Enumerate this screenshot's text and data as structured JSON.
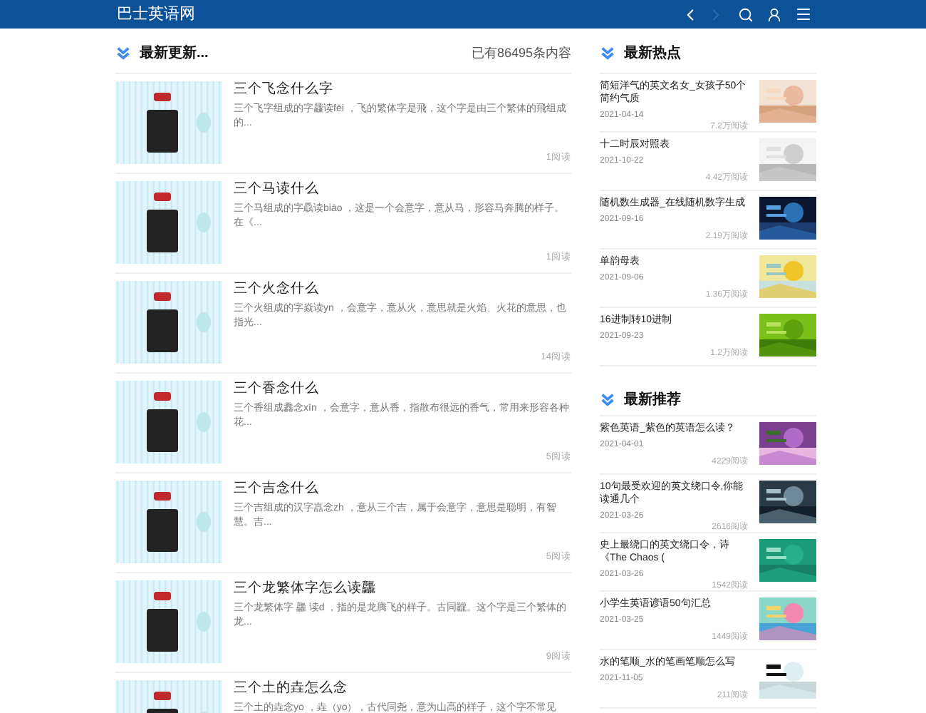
{
  "header": {
    "site_title": "巴士英语网"
  },
  "latest": {
    "title": "最新更新...",
    "count": "已有86495条内容",
    "items": [
      {
        "title": "三个飞念什么字",
        "summary": "三个飞字组成的字飝读fēi ，飞的繁体字是飛，这个字是由三个繁体的飛组成的...",
        "reads": "1阅读"
      },
      {
        "title": "三个马读什么",
        "summary": "三个马组成的字驫读biāo ，这是一个会意字，意从马，形容马奔腾的样子。在《...",
        "reads": "1阅读"
      },
      {
        "title": "三个火念什么",
        "summary": "三个火组成的字焱读yn ，会意字，意从火，意思就是火焰、火花的意思，也指光...",
        "reads": "14阅读"
      },
      {
        "title": "三个香念什么",
        "summary": "三个香组成馫念xīn ，会意字，意从香，指散布很远的香气，常用来形容各种花...",
        "reads": "5阅读"
      },
      {
        "title": "三个吉念什么",
        "summary": "三个吉组成的汉字嚞念zh ，意从三个吉，属于会意字，意思是聪明，有智慧。吉...",
        "reads": "5阅读"
      },
      {
        "title": "三个龙繁体字怎么读龘",
        "summary": "三个龙繁体字 龘 读d ，指的是龙腾飞的样子。古同龖。这个字是三个繁体的龙...",
        "reads": "9阅读"
      },
      {
        "title": "三个土的垚怎么念",
        "summary": "三个土的垚念yo ，垚（yo），古代同尧，意为山高的样子，这个字不常见"
      }
    ]
  },
  "hot": {
    "title": "最新热点",
    "items": [
      {
        "title": "简短洋气的英文名女_女孩子50个简约气质",
        "date": "2021-04-14",
        "reads": "7.2万阅读"
      },
      {
        "title": "十二时辰对照表",
        "date": "2021-10-22",
        "reads": "4.42万阅读"
      },
      {
        "title": "随机数生成器_在线随机数字生成",
        "date": "2021-09-16",
        "reads": "2.19万阅读"
      },
      {
        "title": "单韵母表",
        "date": "2021-09-06",
        "reads": "1.36万阅读"
      },
      {
        "title": "16进制转10进制",
        "date": "2021-09-23",
        "reads": "1.2万阅读"
      }
    ]
  },
  "recommended": {
    "title": "最新推荐",
    "items": [
      {
        "title": "紫色英语_紫色的英语怎么读？",
        "date": "2021-04-01",
        "reads": "4229阅读"
      },
      {
        "title": "10句最受欢迎的英文绕口令,你能读通几个",
        "date": "2021-03-26",
        "reads": "2616阅读"
      },
      {
        "title": "史上最绕口的英文绕口令，诗《The Chaos (",
        "date": "2021-03-26",
        "reads": "1542阅读"
      },
      {
        "title": "小学生英语谚语50句汇总",
        "date": "2021-03-25",
        "reads": "1449阅读"
      },
      {
        "title": "水的笔顺_水的笔画笔顺怎么写",
        "date": "2021-11-05",
        "reads": "211阅读"
      }
    ]
  }
}
